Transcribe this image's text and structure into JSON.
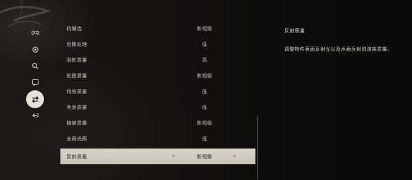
{
  "sidebar": {
    "items": [
      {
        "icon": "gamepad-icon",
        "active": false
      },
      {
        "icon": "display-settings-icon",
        "active": false
      },
      {
        "icon": "search-icon",
        "active": false
      },
      {
        "icon": "chat-icon",
        "active": false
      },
      {
        "icon": "swap-arrows-icon",
        "active": true
      },
      {
        "icon": "exit-icon",
        "active": false
      }
    ]
  },
  "settings": {
    "rows": [
      {
        "name": "抗锯齿",
        "value": "影视级",
        "selected": false
      },
      {
        "name": "后期处理",
        "value": "低",
        "selected": false
      },
      {
        "name": "阴影质量",
        "value": "高",
        "selected": false
      },
      {
        "name": "贴图质量",
        "value": "影视级",
        "selected": false
      },
      {
        "name": "特效质量",
        "value": "低",
        "selected": false
      },
      {
        "name": "毛发质量",
        "value": "低",
        "selected": false
      },
      {
        "name": "植被质量",
        "value": "影视级",
        "selected": false
      },
      {
        "name": "全局光照",
        "value": "低",
        "selected": false
      },
      {
        "name": "反射质量",
        "value": "影视级",
        "selected": true
      }
    ],
    "arrow_left": "‹",
    "arrow_right": "›"
  },
  "description": {
    "title": "反射质量",
    "body": "调整物件表面反射光以及水面反射的渲染质量。"
  },
  "colors": {
    "selected_row_bg": "#d7d3cb",
    "text": "#cfcac1",
    "active_icon_bg": "#e6e2da",
    "background": "#0e0d0c"
  }
}
